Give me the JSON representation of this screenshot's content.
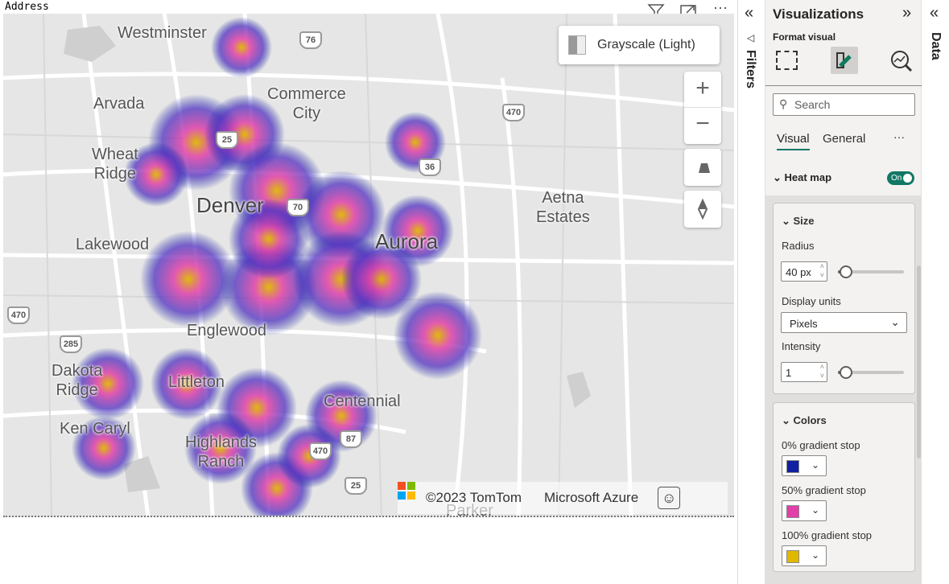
{
  "visual": {
    "title": "Address",
    "header_icons": [
      "filter-icon",
      "focus-mode-icon",
      "more-options-icon"
    ]
  },
  "map": {
    "style_picker": "Grayscale (Light)",
    "copyright": "©2023 TomTom",
    "brand": "Microsoft Azure",
    "places": [
      "Westminster",
      "Arvada",
      "Commerce City",
      "Wheat Ridge",
      "Denver",
      "Aetna Estates",
      "Lakewood",
      "Aurora",
      "Englewood",
      "Dakota Ridge",
      "Littleton",
      "Centennial",
      "Ken Caryl",
      "Highlands Ranch",
      "Parker"
    ],
    "shields": [
      "76",
      "470",
      "25",
      "36",
      "70",
      "470",
      "285",
      "87",
      "470",
      "25"
    ],
    "controls": {
      "zoom_in": "+",
      "zoom_out": "−"
    },
    "heat_colors": {
      "low": "#1020a0",
      "mid": "#e040a8",
      "high": "#e0b800"
    }
  },
  "filters_pane": {
    "label": "Filters"
  },
  "data_pane": {
    "label": "Data"
  },
  "viz": {
    "title": "Visualizations",
    "format_visual": "Format visual",
    "search_placeholder": "Search",
    "tabs": [
      "Visual",
      "General"
    ],
    "more": "···",
    "heat_map": {
      "label": "Heat map",
      "toggle": "On"
    },
    "size": {
      "label": "Size",
      "radius_label": "Radius",
      "radius_value": "40 px",
      "radius_level": 0.1,
      "units_label": "Display units",
      "units_value": "Pixels",
      "intensity_label": "Intensity",
      "intensity_value": "1",
      "intensity_level": 0.1
    },
    "colors": {
      "label": "Colors",
      "stops": [
        {
          "label": "0% gradient stop",
          "color": "#1020a0"
        },
        {
          "label": "50% gradient stop",
          "color": "#e040a8"
        },
        {
          "label": "100% gradient stop",
          "color": "#e0b800"
        }
      ]
    }
  }
}
